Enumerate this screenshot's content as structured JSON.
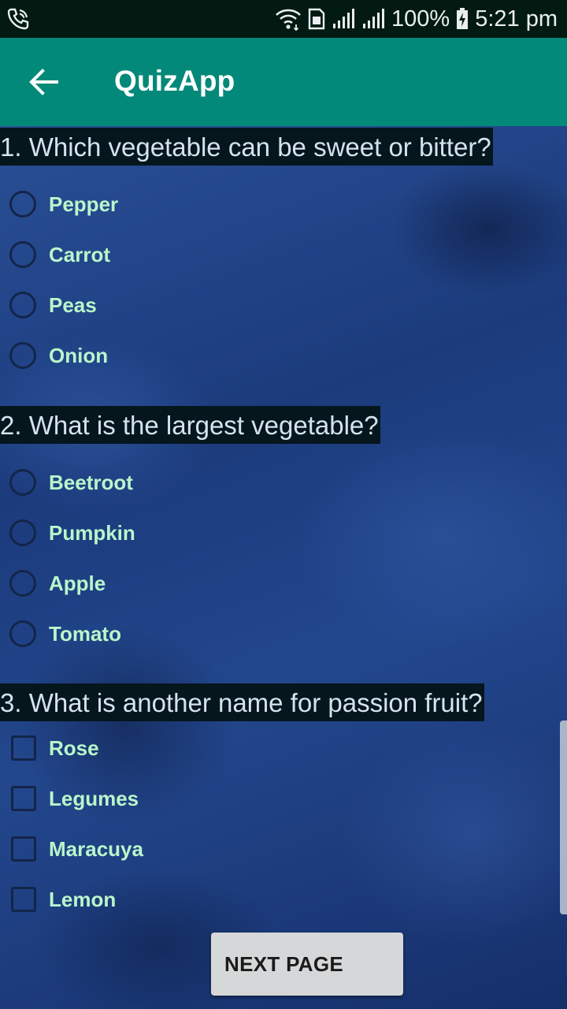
{
  "status_bar": {
    "battery": "100%",
    "time": "5:21 pm",
    "icons": [
      "phone-call-icon",
      "wifi-icon",
      "sim-icon",
      "signal-icon",
      "signal-icon",
      "battery-charging-icon"
    ]
  },
  "app_bar": {
    "title": "QuizApp",
    "back_icon": "arrow-left-icon"
  },
  "questions": [
    {
      "text": "1. Which vegetable can be sweet or bitter?",
      "type": "radio",
      "options": [
        "Pepper",
        "Carrot",
        "Peas",
        "Onion"
      ]
    },
    {
      "text": "2. What is the largest vegetable?",
      "type": "radio",
      "options": [
        "Beetroot",
        "Pumpkin",
        "Apple",
        "Tomato"
      ]
    },
    {
      "text": "3. What is another name for passion fruit?",
      "type": "checkbox",
      "options": [
        "Rose",
        "Legumes",
        "Maracuya",
        "Lemon"
      ]
    }
  ],
  "next_button": {
    "label": "NEXT PAGE",
    "icon": "skip-next-icon"
  },
  "colors": {
    "status_bar": "#021a12",
    "app_bar": "#03897a",
    "question_bg": "#05161d",
    "option_text": "#b9f6ca",
    "button_bg": "#d6d7d8"
  }
}
